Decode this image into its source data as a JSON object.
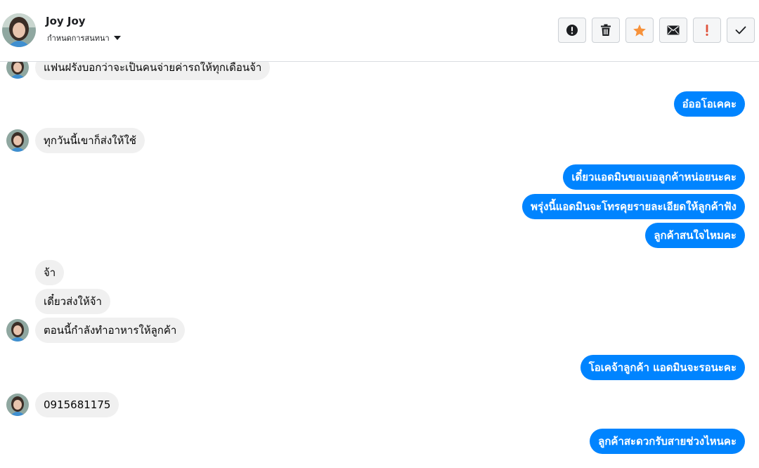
{
  "header": {
    "contact_name": "Joy Joy",
    "assign_label": "กำหนดการสนทนา"
  },
  "toolbar": [
    {
      "name": "spam-button",
      "icon": "alert-circle-icon"
    },
    {
      "name": "delete-button",
      "icon": "trash-icon"
    },
    {
      "name": "star-button",
      "icon": "star-icon",
      "color": "#f7923b"
    },
    {
      "name": "mark-unread-button",
      "icon": "envelope-icon"
    },
    {
      "name": "important-button",
      "icon": "exclamation-icon",
      "color": "#e0533c"
    },
    {
      "name": "mark-done-button",
      "icon": "check-icon"
    }
  ],
  "colors": {
    "outgoing_bubble": "#0084ff",
    "incoming_bubble": "#f0f0f0"
  },
  "messages": [
    {
      "dir": "in",
      "avatar": true,
      "text": "แฟนฝรั่งบอกว่าจะเป็นคนจ่ายค่ารถให้ทุกเดือนจ้า"
    },
    {
      "dir": "out",
      "text": "อ๋ออโอเคคะ"
    },
    {
      "dir": "in",
      "avatar": true,
      "text": "ทุกวันนี้เขาก็ส่งให้ใช้"
    },
    {
      "dir": "out",
      "text": "เดี๋ยวแอดมินขอเบอลูกค้าหน่อยนะคะ"
    },
    {
      "dir": "out",
      "text": "พรุ่งนี้แอดมินจะโทรคุยรายละเอียดให้ลูกค้าฟัง"
    },
    {
      "dir": "out",
      "text": "ลูกค้าสนใจไหมคะ"
    },
    {
      "dir": "in",
      "avatar": false,
      "text": "จ้า"
    },
    {
      "dir": "in",
      "avatar": false,
      "text": "เดี๋ยวส่งให้จ้า"
    },
    {
      "dir": "in",
      "avatar": true,
      "text": "ตอนนี้กำลังทำอาหารให้ลูกค้า"
    },
    {
      "dir": "out",
      "text": "โอเคจ้าลูกค้า แอดมินจะรอนะคะ"
    },
    {
      "dir": "in",
      "avatar": true,
      "text": "0915681175"
    },
    {
      "dir": "out",
      "text": "ลูกค้าสะดวกรับสายช่วงไหนคะ"
    }
  ]
}
